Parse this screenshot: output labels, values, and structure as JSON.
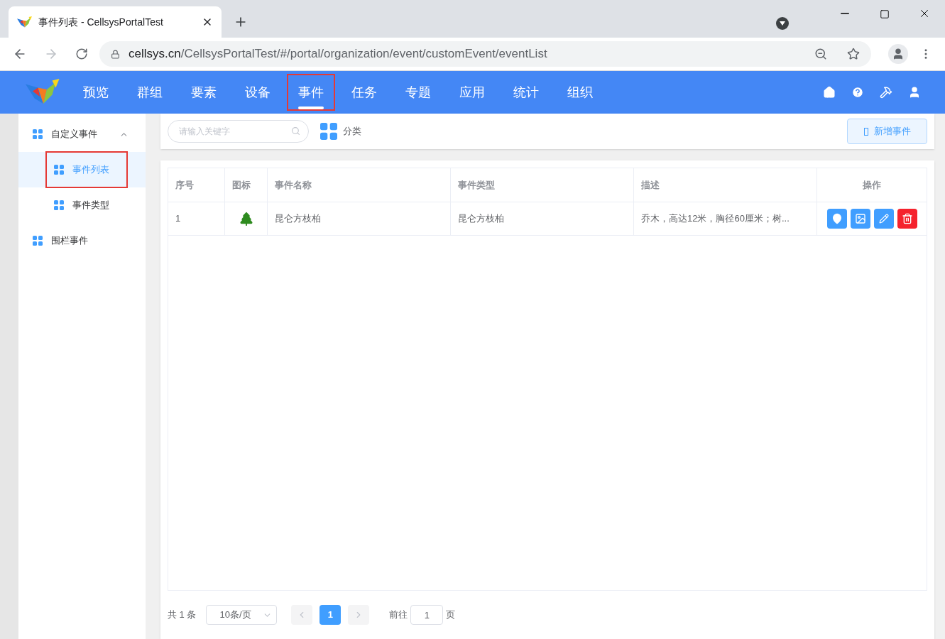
{
  "browser": {
    "tab_title": "事件列表 - CellsysPortalTest",
    "url_host": "cellsys.cn",
    "url_path": "/CellsysPortalTest/#/portal/organization/event/customEvent/eventList"
  },
  "nav": [
    {
      "label": "预览",
      "selected": false,
      "highlighted": false
    },
    {
      "label": "群组",
      "selected": false,
      "highlighted": false
    },
    {
      "label": "要素",
      "selected": false,
      "highlighted": false
    },
    {
      "label": "设备",
      "selected": false,
      "highlighted": false
    },
    {
      "label": "事件",
      "selected": true,
      "highlighted": true
    },
    {
      "label": "任务",
      "selected": false,
      "highlighted": false
    },
    {
      "label": "专题",
      "selected": false,
      "highlighted": false
    },
    {
      "label": "应用",
      "selected": false,
      "highlighted": false
    },
    {
      "label": "统计",
      "selected": false,
      "highlighted": false
    },
    {
      "label": "组织",
      "selected": false,
      "highlighted": false
    }
  ],
  "sidebar": {
    "items": [
      {
        "label": "自定义事件",
        "selected": false,
        "highlighted": false,
        "expanded": true,
        "children": [
          {
            "label": "事件列表",
            "selected": true,
            "highlighted": true
          },
          {
            "label": "事件类型",
            "selected": false,
            "highlighted": false
          }
        ]
      },
      {
        "label": "围栏事件",
        "selected": false,
        "highlighted": false
      }
    ]
  },
  "toolbar": {
    "search": {
      "placeholder": "请输入关键字"
    },
    "category": "分类",
    "add_button": "新增事件"
  },
  "table": {
    "columns": [
      "序号",
      "图标",
      "事件名称",
      "事件类型",
      "描述",
      "操作"
    ],
    "rows": [
      {
        "index": "1",
        "name": "昆仑方枝柏",
        "type": "昆仑方枝柏",
        "description": "乔木，高达12米，胸径60厘米；树..."
      }
    ]
  },
  "pagination": {
    "total": "共 1 条",
    "page_size": "10条/页",
    "pages": [
      {
        "label": "1",
        "selected": true
      }
    ],
    "goto_label": "前往",
    "goto_value": "1",
    "page_suffix": "页"
  }
}
